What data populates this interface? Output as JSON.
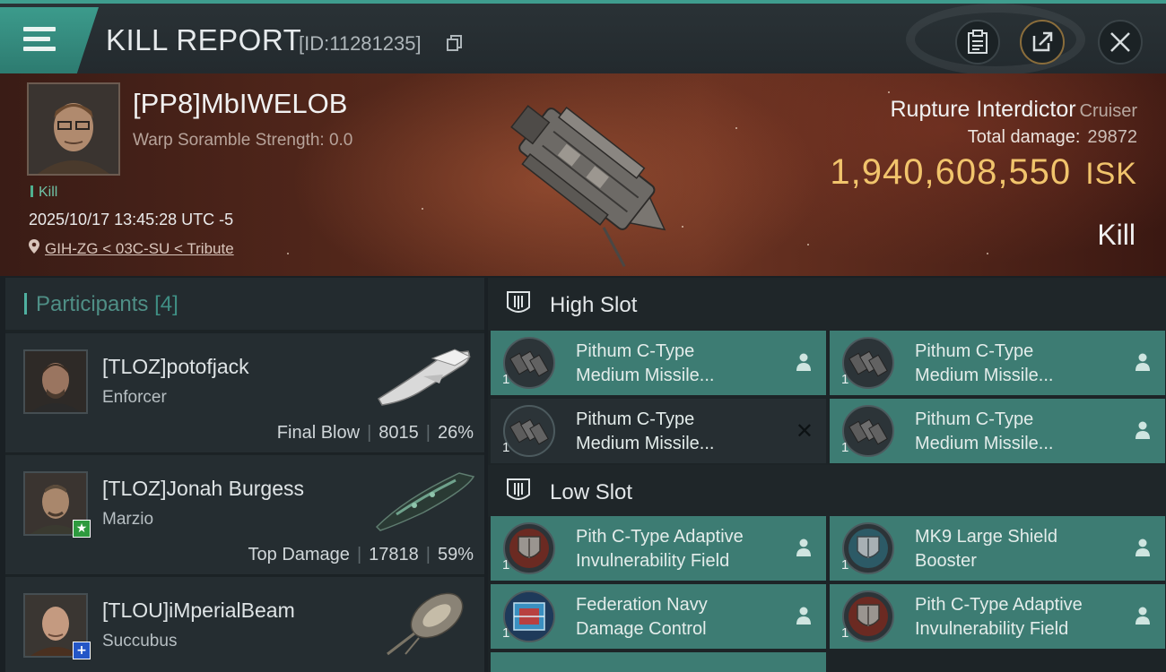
{
  "header": {
    "title": "KILL REPORT",
    "report_id": "[ID:11281235]"
  },
  "victim": {
    "pilot_name": "[PP8]MbIWELOB",
    "warp_scramble": "Warp Soramble Strength: 0.0",
    "kill_tag": "Kill",
    "datetime": "2025/10/17 13:45:28 UTC -5",
    "location": "GIH-ZG < 03C-SU < Tribute",
    "ship_name": "Rupture Interdictor",
    "ship_class": "Cruiser",
    "total_damage_label": "Total damage:",
    "total_damage": "29872",
    "isk_value": "1,940,608,550",
    "isk_unit": "ISK",
    "result": "Kill"
  },
  "participants": {
    "title": "Participants",
    "count": "[4]",
    "items": [
      {
        "name": "[TLOZ]potofjack",
        "ship": "Enforcer",
        "role": "Final Blow",
        "damage": "8015",
        "percent": "26%"
      },
      {
        "name": "[TLOZ]Jonah Burgess",
        "ship": "Marzio",
        "role": "Top Damage",
        "damage": "17818",
        "percent": "59%"
      },
      {
        "name": "[TLOU]iMperialBeam",
        "ship": "Succubus"
      }
    ]
  },
  "slots": {
    "high_title": "High Slot",
    "low_title": "Low Slot",
    "high": [
      {
        "name_line1": "Pithum C-Type",
        "name_line2": "Medium Missile...",
        "qty": "1",
        "state": "person"
      },
      {
        "name_line1": "Pithum C-Type",
        "name_line2": "Medium Missile...",
        "qty": "1",
        "state": "person"
      },
      {
        "name_line1": "Pithum C-Type",
        "name_line2": "Medium Missile...",
        "qty": "1",
        "state": "destroyed"
      },
      {
        "name_line1": "Pithum C-Type",
        "name_line2": "Medium Missile...",
        "qty": "1",
        "state": "person"
      }
    ],
    "low": [
      {
        "name_line1": "Pith C-Type Adaptive",
        "name_line2": "Invulnerability Field",
        "qty": "1",
        "state": "person"
      },
      {
        "name_line1": "MK9 Large Shield",
        "name_line2": "Booster",
        "qty": "1",
        "state": "person"
      },
      {
        "name_line1": "Federation Navy",
        "name_line2": "Damage Control",
        "qty": "1",
        "state": "person"
      },
      {
        "name_line1": "Pith C-Type Adaptive",
        "name_line2": "Invulnerability Field",
        "qty": "1",
        "state": "person"
      }
    ]
  },
  "icons": {
    "menu": "menu-icon",
    "copy": "copy-icon",
    "clipboard": "clipboard-icon",
    "share": "share-icon",
    "close": "close-icon",
    "location": "location-pin-icon",
    "slot": "slot-icon",
    "person": "person-icon"
  },
  "colors": {
    "accent": "#3f9d8e",
    "isk": "#f1c46c",
    "module_fitted": "#3d7c73",
    "module_destroyed": "#262e32"
  }
}
